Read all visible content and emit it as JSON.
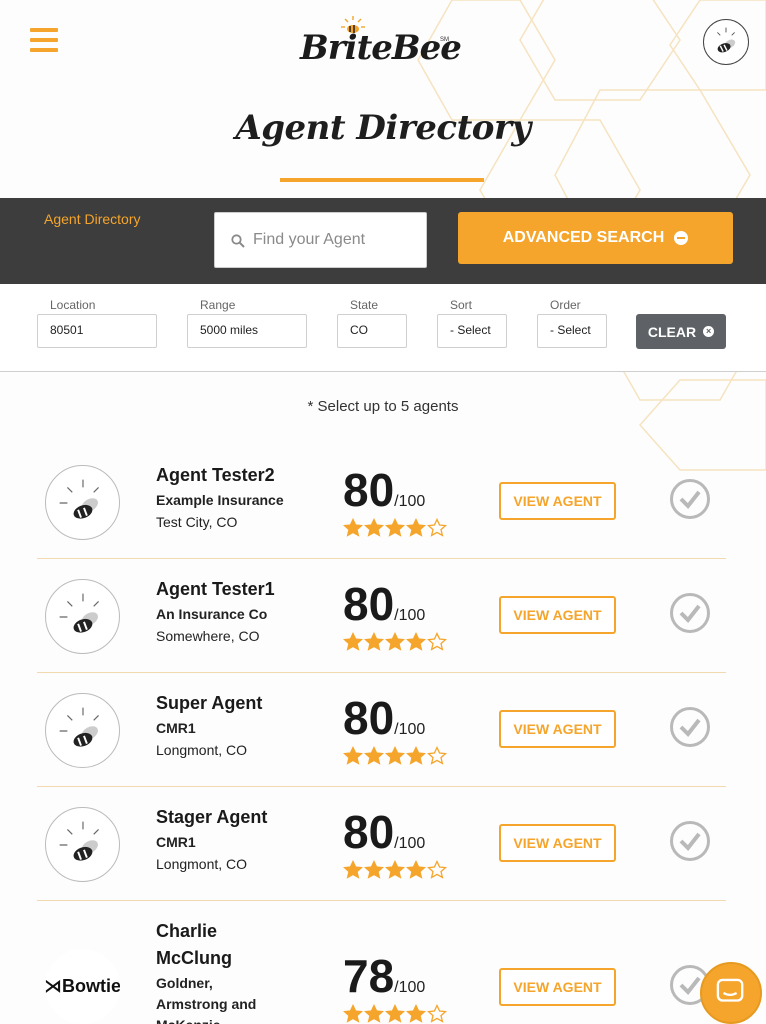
{
  "header": {
    "logo_text": "BriteBee",
    "logo_mark": "SM",
    "menu_icon": "hamburger-menu-icon",
    "profile_icon": "bee-avatar-icon"
  },
  "page_title": "Agent Directory",
  "search_band": {
    "section_label": "Agent Directory",
    "search_placeholder": "Find your Agent",
    "search_icon": "search-icon",
    "advanced_search_label": "ADVANCED SEARCH",
    "advanced_search_icon": "minus-circle-icon"
  },
  "filters": {
    "location": {
      "label": "Location",
      "value": "80501"
    },
    "range": {
      "label": "Range",
      "value": "5000 miles"
    },
    "state": {
      "label": "State",
      "value": "CO"
    },
    "sort": {
      "label": "Sort",
      "value": "- Select"
    },
    "order": {
      "label": "Order",
      "value": "- Select"
    },
    "clear_label": "CLEAR",
    "clear_icon": "close-circle-icon"
  },
  "select_note": "* Select up to 5 agents",
  "agents": [
    {
      "name": "Agent Tester2",
      "company": "Example Insurance",
      "location": "Test City, CO",
      "score": "80",
      "score_max": "/100",
      "stars": 4,
      "button": "VIEW AGENT",
      "avatar": "bee-avatar-icon"
    },
    {
      "name": "Agent Tester1",
      "company": "An Insurance Co",
      "location": "Somewhere, CO",
      "score": "80",
      "score_max": "/100",
      "stars": 4,
      "button": "VIEW AGENT",
      "avatar": "bee-avatar-icon"
    },
    {
      "name": "Super Agent",
      "company": "CMR1",
      "location": "Longmont, CO",
      "score": "80",
      "score_max": "/100",
      "stars": 4,
      "button": "VIEW AGENT",
      "avatar": "bee-avatar-icon"
    },
    {
      "name": "Stager Agent",
      "company": "CMR1",
      "location": "Longmont, CO",
      "score": "80",
      "score_max": "/100",
      "stars": 4,
      "button": "VIEW AGENT",
      "avatar": "bee-avatar-icon"
    },
    {
      "name_line1": "Charlie",
      "name_line2": "McClung",
      "company_line1": "Goldner,",
      "company_line2": "Armstrong and",
      "company_line3": "McKenzie",
      "score": "78",
      "score_max": "/100",
      "stars": 4,
      "button": "VIEW AGENT",
      "avatar_text": "Bowtie"
    }
  ],
  "colors": {
    "accent": "#f5a52b",
    "dark_band": "#3d3d3d",
    "clear_button": "#5e6266"
  },
  "chat_icon": "chat-bubble-icon"
}
